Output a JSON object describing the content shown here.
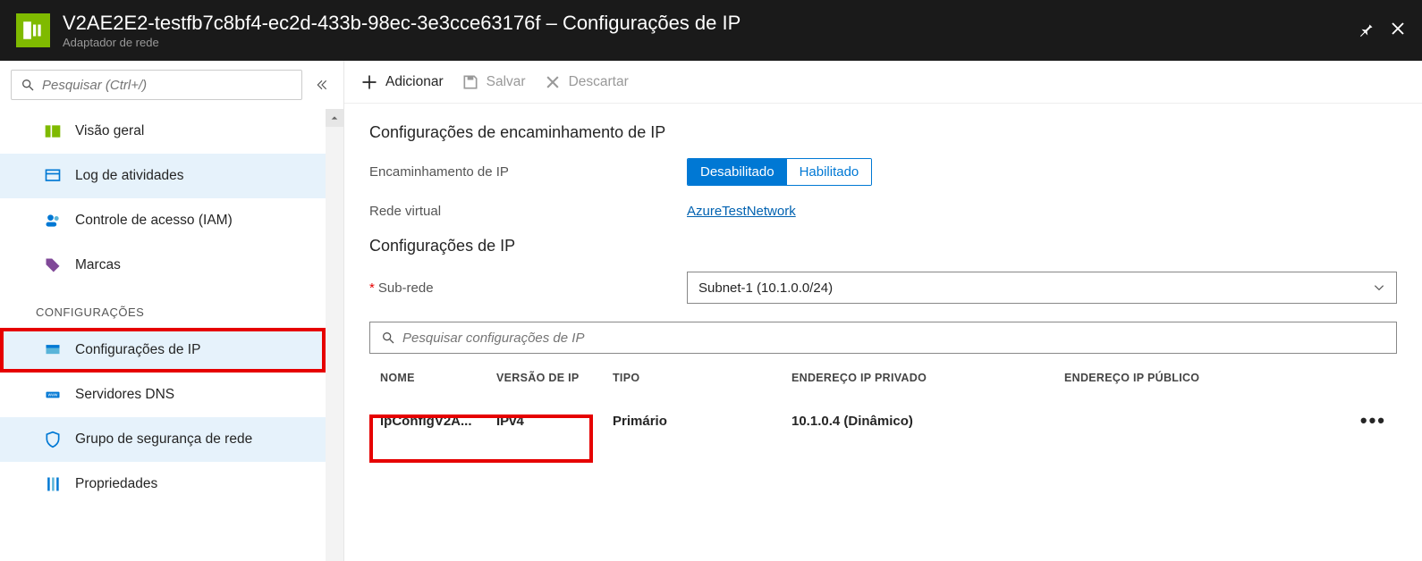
{
  "header": {
    "title": "V2AE2E2-testfb7c8bf4-ec2d-433b-98ec-3e3cce63176f – Configurações de IP",
    "subtitle": "Adaptador de rede"
  },
  "sidebar": {
    "search_placeholder": "Pesquisar (Ctrl+/)",
    "items": {
      "overview": "Visão geral",
      "activity_log": "Log de atividades",
      "iam": "Controle de acesso (IAM)",
      "tags": "Marcas"
    },
    "section_label": "CONFIGURAÇÕES",
    "config_items": {
      "ipconfig": "Configurações de IP",
      "dns": "Servidores DNS",
      "nsg": "Grupo de segurança de rede",
      "props": "Propriedades"
    }
  },
  "toolbar": {
    "add": "Adicionar",
    "save": "Salvar",
    "discard": "Descartar"
  },
  "forwarding": {
    "title": "Configurações de encaminhamento de IP",
    "label": "Encaminhamento de IP",
    "disabled": "Desabilitado",
    "enabled": "Habilitado",
    "vnet_label": "Rede virtual",
    "vnet_value": "AzureTestNetwork"
  },
  "ipconfig": {
    "title": "Configurações de IP",
    "subnet_label": "Sub-rede",
    "subnet_value": "Subnet-1 (10.1.0.0/24)",
    "filter_placeholder": "Pesquisar configurações de IP",
    "columns": {
      "name": "NOME",
      "version": "VERSÃO DE IP",
      "type": "TIPO",
      "private": "ENDEREÇO IP PRIVADO",
      "public": "ENDEREÇO IP PÚBLICO"
    },
    "rows": [
      {
        "name": "ipConfigV2A...",
        "version": "IPv4",
        "type": "Primário",
        "private": "10.1.0.4 (Dinâmico)",
        "public": ""
      }
    ]
  }
}
